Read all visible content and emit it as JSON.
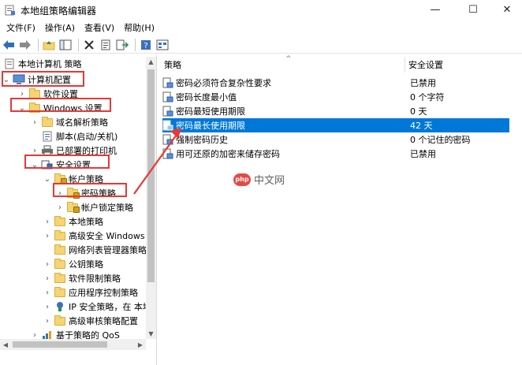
{
  "window": {
    "title": "本地组策略编辑器",
    "controls": {
      "minimize": "—",
      "maximize": "☐",
      "close": "✕"
    }
  },
  "menu": [
    "文件(F)",
    "操作(A)",
    "查看(V)",
    "帮助(H)"
  ],
  "toolbar": {
    "icons": [
      "back-arrow-icon",
      "forward-arrow-icon",
      "up-folder-icon",
      "show-tree-icon",
      "delete-icon",
      "properties-icon",
      "export-icon",
      "help-icon",
      "view-icon"
    ]
  },
  "tree": {
    "root": "本地计算机 策略",
    "computer_config": "计算机配置",
    "software_settings": "软件设置",
    "windows_settings": "Windows 设置",
    "dns_policy": "域名解析策略",
    "scripts": "脚本(启动/关机)",
    "printers": "已部署的打印机",
    "security_settings": "安全设置",
    "account_policy": "帐户策略",
    "password_policy": "密码策略",
    "lockout_policy": "帐户锁定策略",
    "local_policy": "本地策略",
    "advanced_firewall": "高级安全 Windows",
    "network_list": "网络列表管理器策略",
    "public_key": "公钥策略",
    "software_restriction": "软件限制策略",
    "app_control": "应用程序控制策略",
    "ip_security": "IP 安全策略，在 本地",
    "audit_policy": "高级审核策略配置",
    "qos": "基于策略的 QoS"
  },
  "table": {
    "col_policy": "策略",
    "col_setting": "安全设置",
    "sort_caret": "^",
    "rows": [
      {
        "name": "密码必须符合复杂性要求",
        "value": "已禁用"
      },
      {
        "name": "密码长度最小值",
        "value": "0 个字符"
      },
      {
        "name": "密码最短使用期限",
        "value": "0 天"
      },
      {
        "name": "密码最长使用期限",
        "value": "42 天"
      },
      {
        "name": "强制密码历史",
        "value": "0 个记住的密码"
      },
      {
        "name": "用可还原的加密来储存密码",
        "value": "已禁用"
      }
    ],
    "selected_index": 3
  },
  "watermark": {
    "logo": "php",
    "text": "中文网"
  },
  "colors": {
    "selection": "#0078d7",
    "annotation": "#e53935",
    "folder": "#f5d473"
  }
}
